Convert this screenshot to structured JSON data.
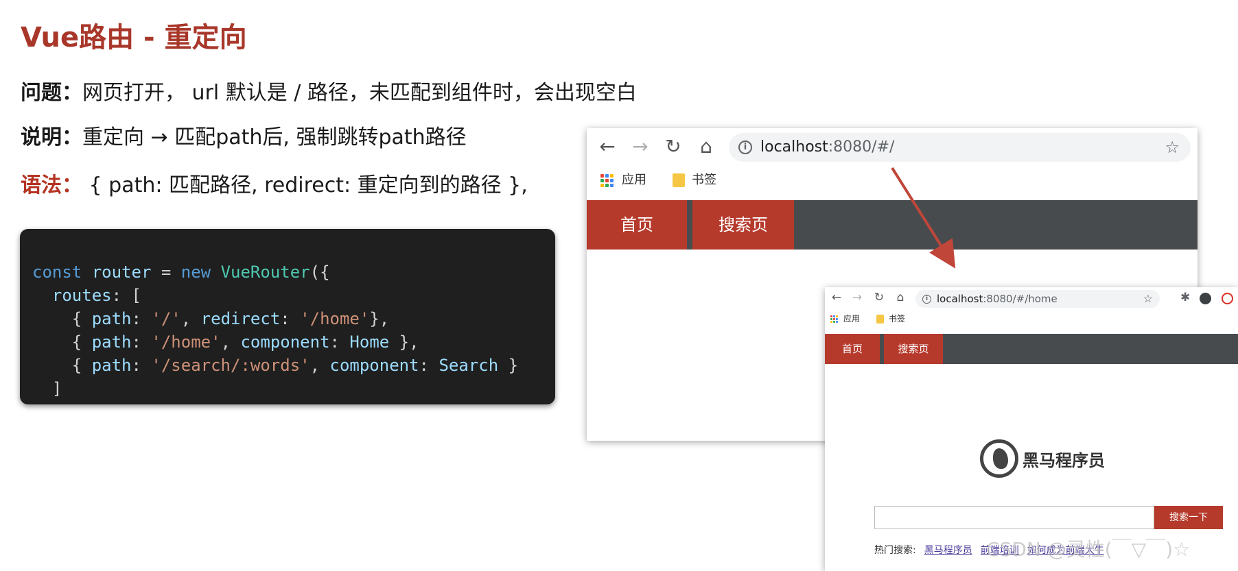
{
  "slide": {
    "title": "Vue路由 - 重定向",
    "problem_label": "问题：",
    "problem_text": "网页打开， url 默认是 / 路径，未匹配到组件时，会出现空白",
    "explain_label": "说明：",
    "explain_text": "重定向 → 匹配path后, 强制跳转path路径",
    "syntax_label": "语法：",
    "syntax_text": " { path: 匹配路径, redirect: 重定向到的路径 },"
  },
  "code": {
    "l1": {
      "kw1": "const",
      "var": " router",
      "op": " = ",
      "kw2": "new",
      "cls": " VueRouter",
      "end": "({"
    },
    "l2": {
      "prop": "  routes",
      "end": ": ["
    },
    "l3": {
      "a": "    { ",
      "p1": "path",
      "b": ": ",
      "s1": "'/'",
      "c": ", ",
      "p2": "redirect",
      "d": ": ",
      "s2": "'/home'",
      "e": "},"
    },
    "l4": {
      "a": "    { ",
      "p1": "path",
      "b": ": ",
      "s1": "'/home'",
      "c": ", ",
      "p2": "component",
      "d": ": ",
      "v": "Home",
      "e": " },"
    },
    "l5": {
      "a": "    { ",
      "p1": "path",
      "b": ": ",
      "s1": "'/search/:words'",
      "c": ", ",
      "p2": "component",
      "d": ": ",
      "v": "Search",
      "e": " }"
    },
    "l6": "  ]",
    "l7": "})"
  },
  "browser1": {
    "back": "←",
    "forward": "→",
    "reload": "↻",
    "home": "⌂",
    "info": "i",
    "url_host": "localhost",
    "url_rest": ":8080/#/",
    "star": "☆",
    "bookmark_apps": "应用",
    "bookmark_folder": "书签",
    "nav_home": "首页",
    "nav_search": "搜索页"
  },
  "browser2": {
    "back": "←",
    "forward": "→",
    "reload": "↻",
    "home": "⌂",
    "info": "i",
    "url_host": "localhost",
    "url_rest": ":8080/#/home",
    "star": "☆",
    "puzzle": "✱",
    "bookmark_apps": "应用",
    "bookmark_folder": "书签",
    "nav_home": "首页",
    "nav_search": "搜索页",
    "logo_text": "黑马程序员",
    "search_button": "搜索一下",
    "hot_label": "热门搜索:",
    "hot_links": [
      "黑马程序员",
      "前端培训",
      "如何成为前端大牛"
    ]
  },
  "watermark": "CSDN @灵性(￣▽￣)☆",
  "colors": {
    "title": "#a8372a",
    "syntax_label": "#b43322",
    "nav_bar": "#474b4e",
    "nav_active": "#b63a2c",
    "arrow": "#c0463a"
  }
}
